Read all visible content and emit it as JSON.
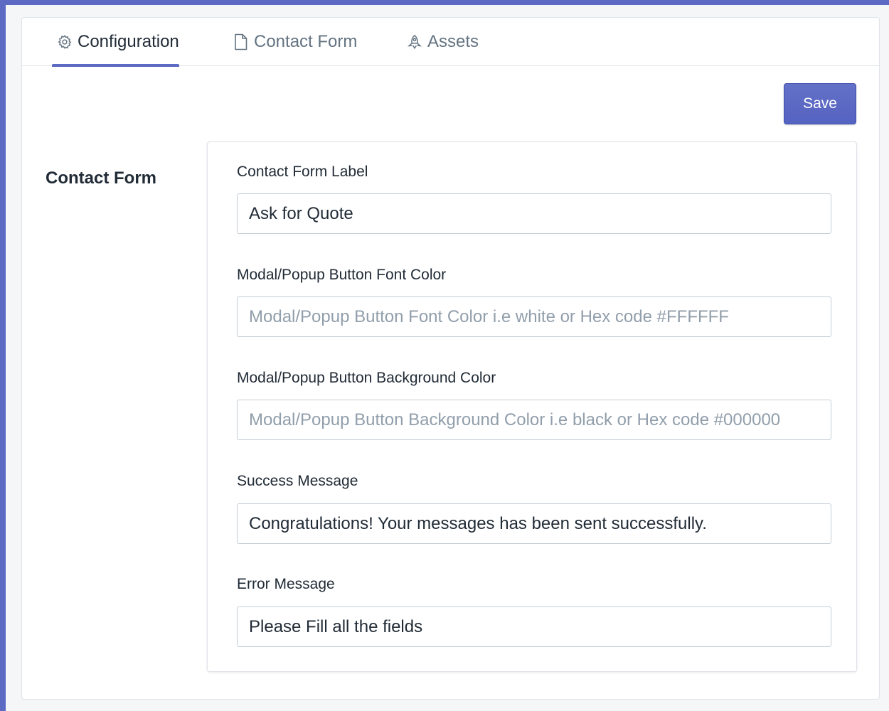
{
  "tabs": [
    {
      "label": "Configuration",
      "icon": "gear-icon",
      "active": true
    },
    {
      "label": "Contact Form",
      "icon": "document-icon",
      "active": false
    },
    {
      "label": "Assets",
      "icon": "rocket-icon",
      "active": false
    }
  ],
  "toolbar": {
    "save_label": "Save"
  },
  "section": {
    "title": "Contact Form"
  },
  "fields": [
    {
      "label": "Contact Form Label",
      "value": "Ask for Quote",
      "placeholder": ""
    },
    {
      "label": "Modal/Popup Button Font Color",
      "value": "",
      "placeholder": "Modal/Popup Button Font Color i.e white or Hex code #FFFFFF"
    },
    {
      "label": "Modal/Popup Button Background Color",
      "value": "",
      "placeholder": "Modal/Popup Button Background Color i.e black or Hex code #000000"
    },
    {
      "label": "Success Message",
      "value": "Congratulations! Your messages has been sent successfully.",
      "placeholder": ""
    },
    {
      "label": "Error Message",
      "value": "Please Fill all the fields",
      "placeholder": ""
    }
  ],
  "colors": {
    "accent": "#5c6ac4",
    "text": "#212b36",
    "muted": "#637381",
    "border": "#c4cdd5"
  }
}
